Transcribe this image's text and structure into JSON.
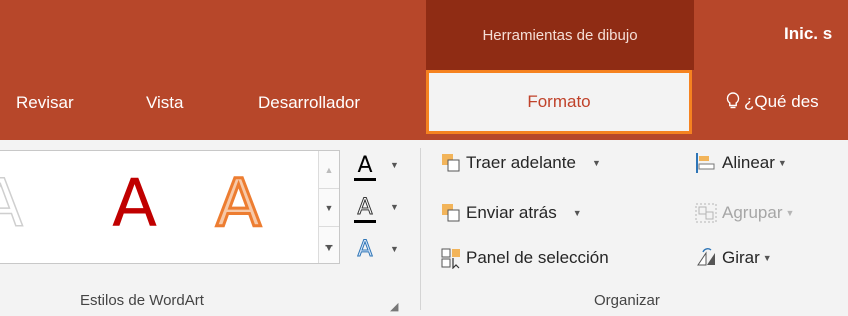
{
  "header": {
    "contextual_group": "Herramientas de dibujo",
    "signin_label": "Inic. s"
  },
  "tabs": {
    "revisar": "Revisar",
    "vista": "Vista",
    "desarrollador": "Desarrollador",
    "formato": "Formato",
    "tell_me": "¿Qué des"
  },
  "wordart": {
    "styles": [
      "A",
      "A",
      "A"
    ],
    "text_fill_glyph": "A",
    "text_outline_glyph": "A",
    "text_effects_glyph": "A",
    "group_label": "Estilos de WordArt"
  },
  "organizar": {
    "traer_adelante": "Traer adelante",
    "enviar_atras": "Enviar atrás",
    "panel_seleccion": "Panel de selección",
    "alinear": "Alinear",
    "agrupar": "Agrupar",
    "girar": "Girar",
    "group_label": "Organizar"
  },
  "colors": {
    "ribbon_accent": "#b7472a",
    "contextual_header": "#8f2c14",
    "highlight_border": "#f58220",
    "ribbon_background": "#f3f3f3"
  }
}
